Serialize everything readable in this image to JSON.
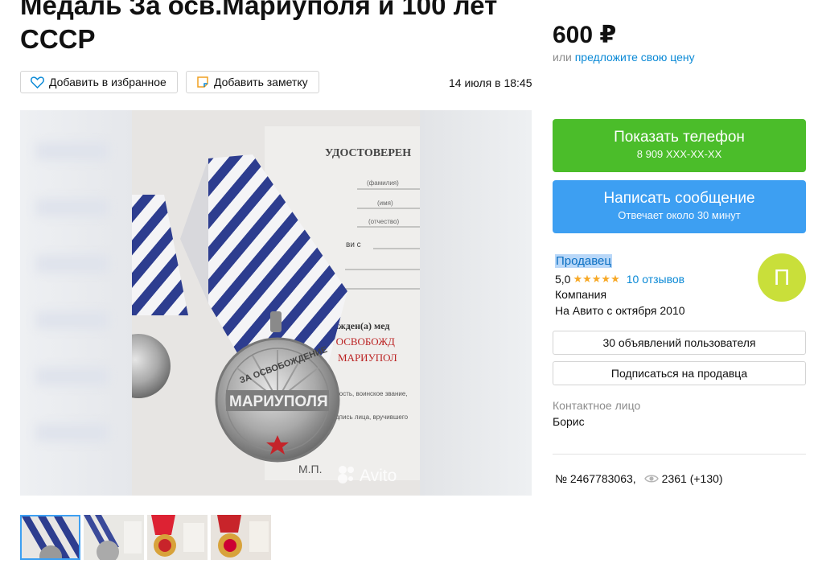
{
  "listing": {
    "title": "Медаль За осв.Мариуполя и 100 лет СССР",
    "price": "600 ₽",
    "price_or": "или",
    "price_offer_link": "предложите свою цену",
    "date": "14 июля в 18:45",
    "number": "№ 2467783063,",
    "views": "2361 (+130)"
  },
  "actions": {
    "favorite_label": "Добавить в избранное",
    "note_label": "Добавить заметку",
    "show_phone_label": "Показать телефон",
    "phone_masked": "8 909 XXX-XX-XX",
    "message_label": "Написать сообщение",
    "message_sub": "Отвечает около 30 минут"
  },
  "seller": {
    "label": "Продавец",
    "rating": "5,0",
    "stars": "★★★★★",
    "reviews": "10 отзывов",
    "type": "Компания",
    "since": "На Авито с октября 2010",
    "avatar_letter": "П",
    "ads_button": "30 объявлений пользователя",
    "subscribe_button": "Подписаться на продавца",
    "contact_label": "Контактное лицо",
    "contact_name": "Борис"
  },
  "photo": {
    "doc_title": "УДОСТОВЕРЕН",
    "fields": [
      "(фамилия)",
      "(имя)",
      "(отчество)"
    ],
    "field_vi": "ви с",
    "awarded": "награжден(а) мед",
    "award_name": "«ЗА ОСВОБОЖД",
    "award_city": "МАРИУПОЛ",
    "foot1": "жность, воинское звание,",
    "foot2": "дпись лица, вручившего",
    "mp": "М.П.",
    "watermark": "Avito",
    "medal_top": "ЗА ОСВОБОЖДЕНИЕ",
    "medal_city": "МАРИУПОЛЯ"
  },
  "colors": {
    "green": "#4bbd2a",
    "blue": "#3d9ff2",
    "link": "#0a89d6",
    "star": "#f7a825",
    "avatar": "#c9df3a"
  }
}
